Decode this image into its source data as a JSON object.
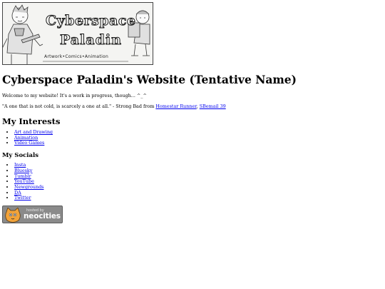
{
  "banner": {
    "title": "Cyberspace",
    "subtitle": "Paladin",
    "tagline": "Artwork•Comics•Animation"
  },
  "page_title": "Cyberspace Paladin's Website (Tentative Name)",
  "welcome_text": "Welcome to my website! It's a work in progress, though... ^_^",
  "quote": {
    "text": "\"A one that is not cold, is scarcely a one at all.\" - Strong Bad from ",
    "link1": "Homestar Runner",
    "separator": ", ",
    "link2": "SBemail 39"
  },
  "interests": {
    "heading": "My Interests",
    "items": [
      {
        "label": "Art and Drawing"
      },
      {
        "label": "Animation"
      },
      {
        "label": "Video Games"
      }
    ]
  },
  "socials": {
    "heading": "My Socials",
    "items": [
      {
        "label": "Insta"
      },
      {
        "label": "Bluesky"
      },
      {
        "label": "Tumblr"
      },
      {
        "label": "YouTube"
      },
      {
        "label": "Newgrounds"
      },
      {
        "label": "DA"
      },
      {
        "label": "Twitter"
      }
    ]
  },
  "neocities_badge": {
    "small_text": "hosted by",
    "brand": "neocities"
  },
  "colors": {
    "link": "#0000ee",
    "badge_bg": "#8a8a8a"
  }
}
